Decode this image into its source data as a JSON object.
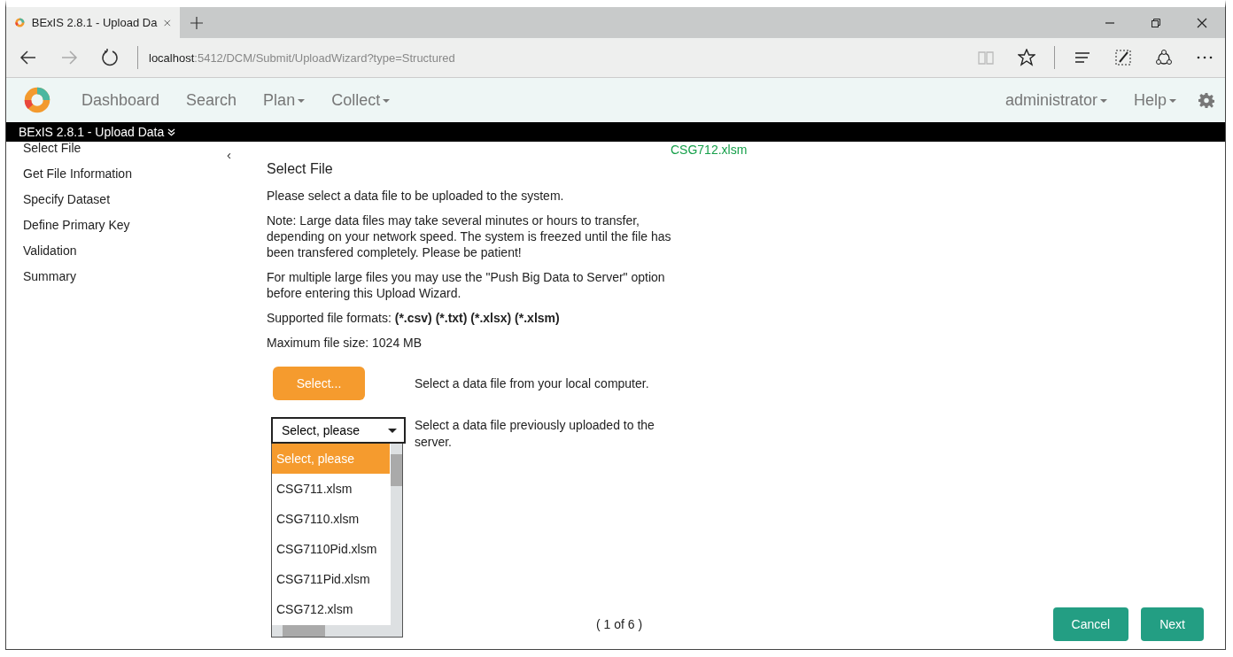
{
  "browser": {
    "tab_title": "BExIS 2.8.1 - Upload Da",
    "address_host": "localhost",
    "address_path": ":5412/DCM/Submit/UploadWizard?type=Structured"
  },
  "nav": {
    "left": [
      {
        "label": "Dashboard",
        "dropdown": false
      },
      {
        "label": "Search",
        "dropdown": false
      },
      {
        "label": "Plan",
        "dropdown": true
      },
      {
        "label": "Collect",
        "dropdown": true
      }
    ],
    "right": [
      {
        "label": "administrator",
        "dropdown": true
      },
      {
        "label": "Help",
        "dropdown": true
      }
    ]
  },
  "title_bar": "BExIS 2.8.1 - Upload Data",
  "steps": [
    "Select File",
    "Get File Information",
    "Specify Dataset",
    "Define Primary Key",
    "Validation",
    "Summary"
  ],
  "collapse": "‹",
  "selected_file": "CSG712.xlsm",
  "heading": "Select File",
  "paragraphs": [
    "Please select a data file to be uploaded to the system.",
    "Note: Large data files may take several minutes or hours to transfer, depending on your network speed. The system is freezed until the file has been transfered completely. Please be patient!",
    "For multiple large files you may use the \"Push Big Data to Server\" option before entering this Upload Wizard.",
    "Maximum file size: 1024 MB"
  ],
  "formats": {
    "label": "Supported file formats:",
    "value": "(*.csv) (*.txt) (*.xlsx) (*.xlsm)"
  },
  "select_button": "Select...",
  "select_hint": "Select a data file from your local computer.",
  "dropdown": {
    "value": "Select, please",
    "hint": "Select a data file previously uploaded to the server.",
    "options": [
      {
        "label": "Select, please",
        "selected": true
      },
      {
        "label": "CSG711.xlsm",
        "selected": false
      },
      {
        "label": "CSG7110.xlsm",
        "selected": false
      },
      {
        "label": "CSG7110Pid.xlsm",
        "selected": false
      },
      {
        "label": "CSG711Pid.xlsm",
        "selected": false
      },
      {
        "label": "CSG712.xlsm",
        "selected": false
      }
    ]
  },
  "pager": "( 1 of 6 )",
  "buttons": [
    "Cancel",
    "Next"
  ]
}
